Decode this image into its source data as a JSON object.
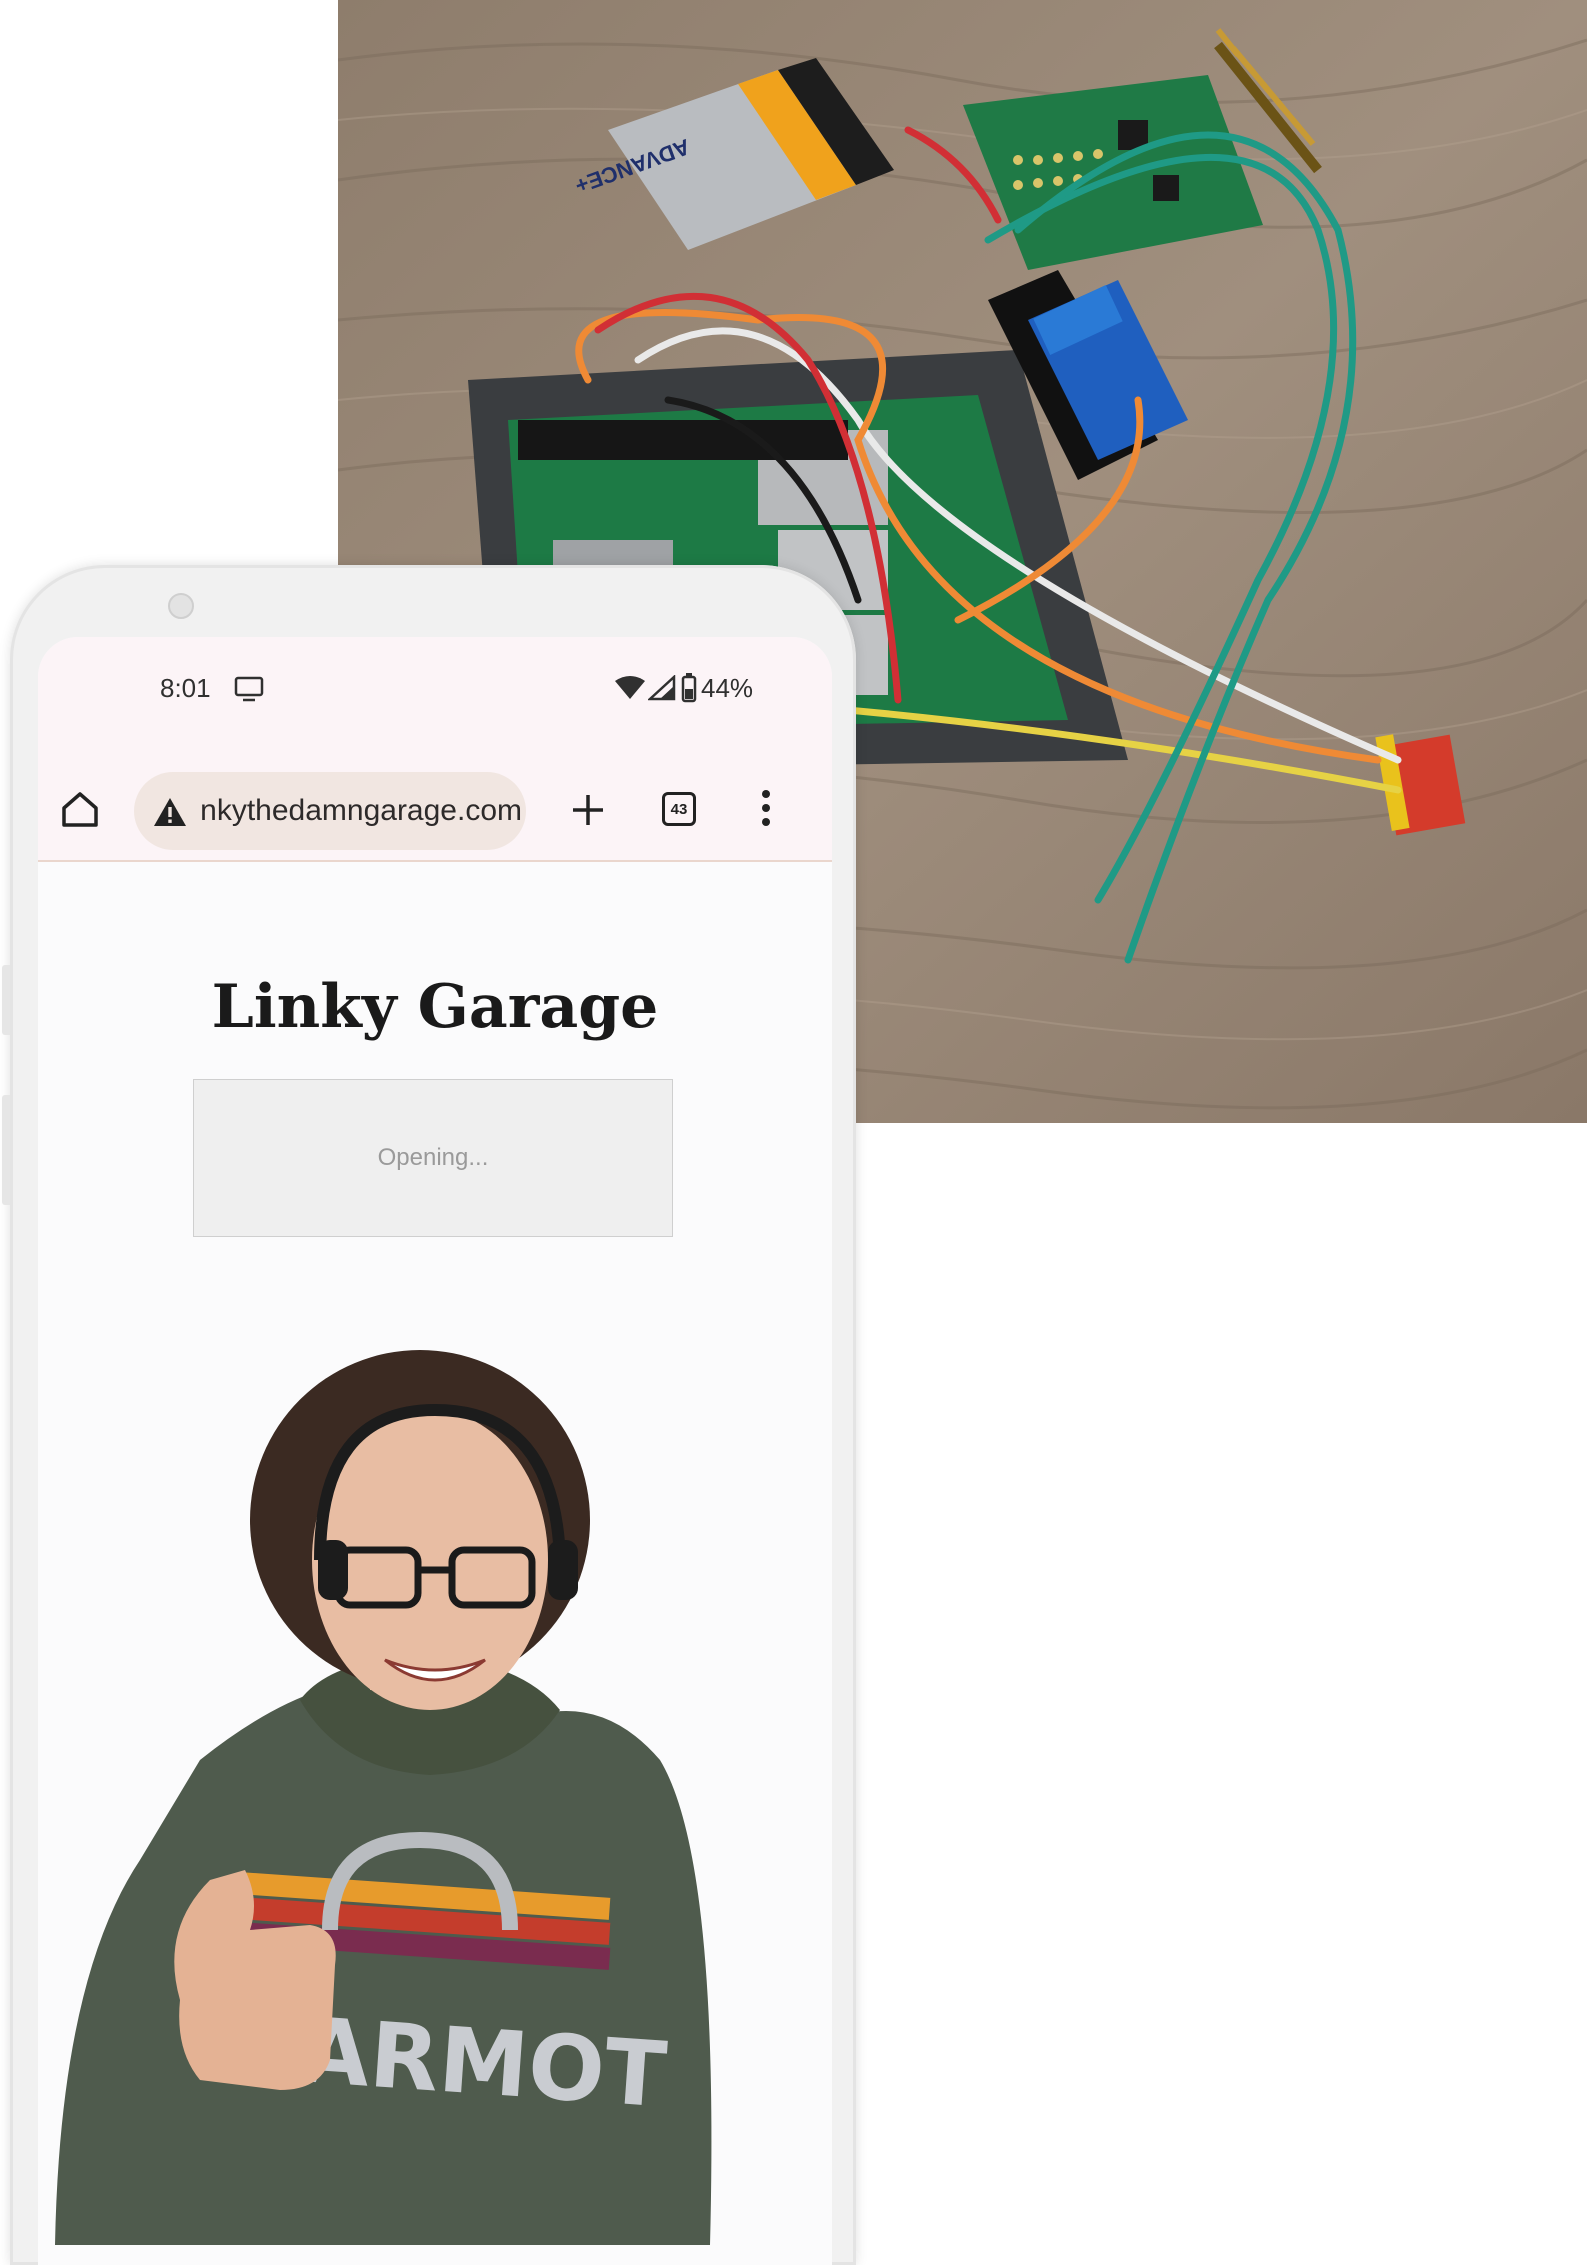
{
  "status_bar": {
    "time": "8:01",
    "battery": "44%"
  },
  "browser": {
    "url": "linkythedamngarage.com",
    "tab_count": "43",
    "icons": [
      "home-icon",
      "warning-icon",
      "new-tab-plus-icon",
      "tab-switcher-icon",
      "more-vert-icon"
    ]
  },
  "page": {
    "title": "Linky Garage",
    "button_label": "Opening..."
  },
  "photo": {
    "battery_label": "ADVANCE+"
  },
  "presenter": {
    "hoodie_text": "ARMOT"
  },
  "colors": {
    "status_bg": "#fcf4f7",
    "url_pill": "#f1e6e1",
    "button_bg": "#efefef",
    "button_text": "#9a9a9a",
    "wood": "#9c8a78",
    "pcb_green": "#1f7a46",
    "relay_blue": "#1f5fbf",
    "hoodie": "#4f5b4d"
  }
}
